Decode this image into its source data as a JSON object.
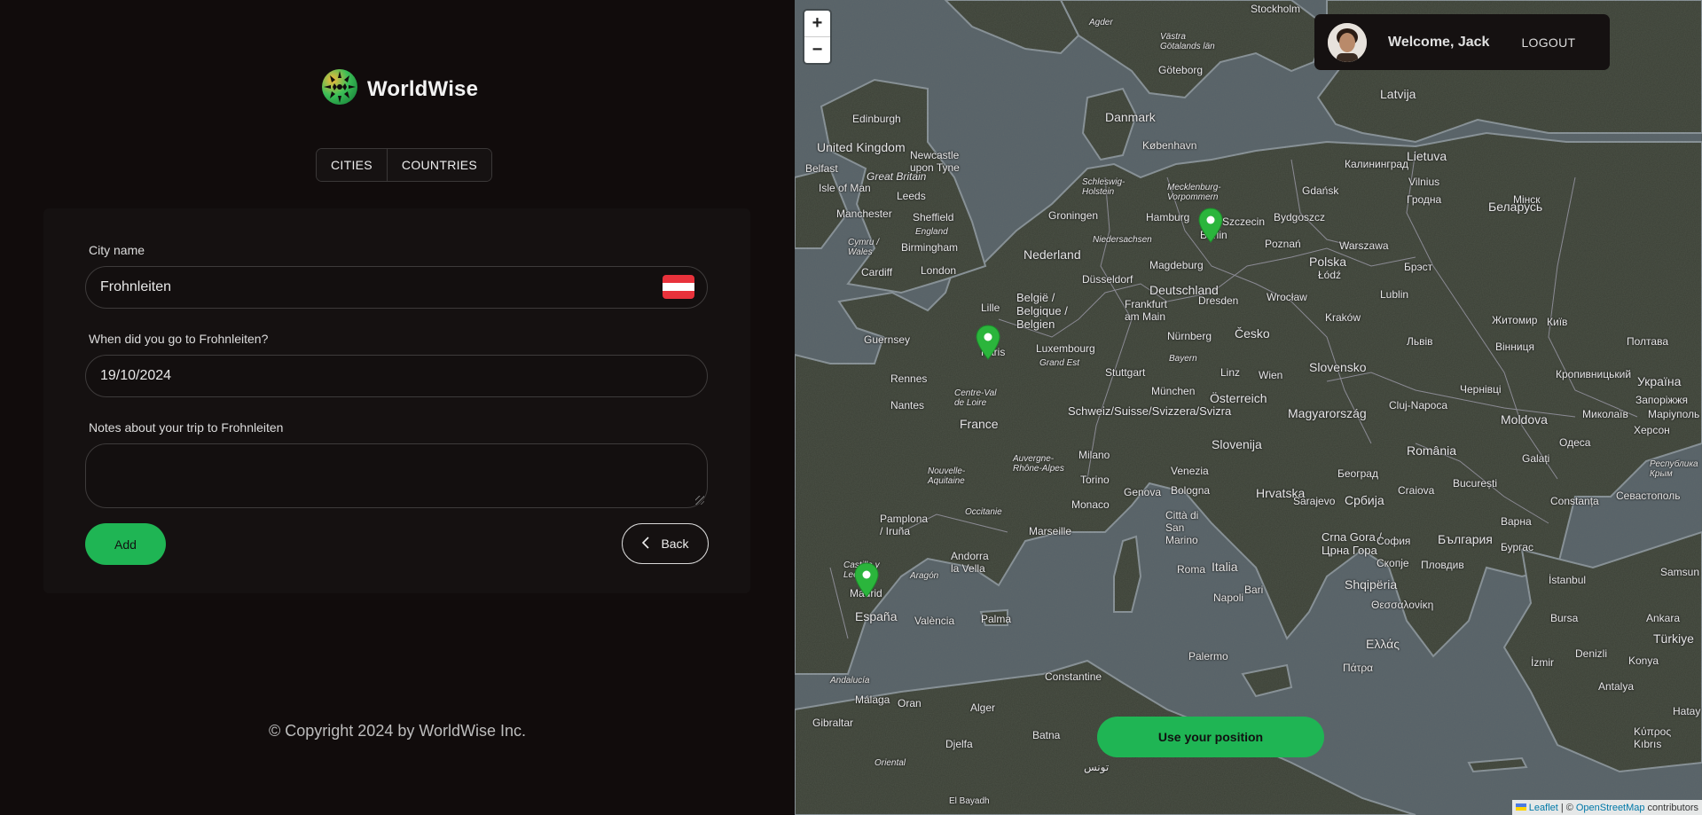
{
  "app": {
    "name": "WorldWise"
  },
  "tabs": [
    {
      "label": "CITIES"
    },
    {
      "label": "COUNTRIES"
    }
  ],
  "form": {
    "city_label": "City name",
    "city_value": "Frohnleiten",
    "flag_colors": [
      "#e8323b",
      "#ffffff",
      "#e8323b"
    ],
    "date_label": "When did you go to Frohnleiten?",
    "date_value": "19/10/2024",
    "notes_label": "Notes about your trip to Frohnleiten",
    "notes_value": "",
    "add_label": "Add",
    "back_label": "Back",
    "back_icon": "chevron-left-icon"
  },
  "footer": {
    "copyright": "© Copyright 2024 by WorldWise Inc."
  },
  "user": {
    "welcome": "Welcome, Jack",
    "logout_label": "LOGOUT"
  },
  "map": {
    "zoom_in": "+",
    "zoom_out": "−",
    "use_position_label": "Use your position",
    "attribution": {
      "leaflet": "Leaflet",
      "sep": "| ©",
      "osm": "OpenStreetMap",
      "suffix": "contributors"
    },
    "markers": [
      {
        "city": "Berlin"
      },
      {
        "city": "Paris"
      },
      {
        "city": "Madrid"
      }
    ],
    "places": {
      "united_kingdom": "United Kingdom",
      "great_britain": "Great Britain",
      "england": "England",
      "edinburgh": "Edinburgh",
      "newcastle": "Newcastle upon Tyne",
      "belfast": "Belfast",
      "isle_of_man": "Isle of Man",
      "leeds": "Leeds",
      "manchester": "Manchester",
      "sheffield": "Sheffield",
      "birmingham": "Birmingham",
      "cymru": "Cymru / Wales",
      "cardiff": "Cardiff",
      "london": "London",
      "guernsey": "Guernsey",
      "rennes": "Rennes",
      "nantes": "Nantes",
      "lille": "Lille",
      "paris": "Paris",
      "centre_val_de_loire": "Centre-Val de Loire",
      "france": "France",
      "nouvelle_aquitaine": "Nouvelle-Aquitaine",
      "occitanie": "Occitanie",
      "auvergne": "Auvergne-Rhône-Alpes",
      "marseille": "Marseille",
      "monaco": "Monaco",
      "andorra": "Andorra la Vella",
      "pamplona": "Pamplona / Iruña",
      "castilla": "Castilla y León",
      "aragon": "Aragón",
      "madrid": "Madrid",
      "espana": "España",
      "valencia": "València",
      "palma": "Palma",
      "andalucia": "Andalucía",
      "malaga": "Málaga",
      "gibraltar": "Gibraltar",
      "nederland": "Nederland",
      "belgie": "België / Belgique / Belgien",
      "dusseldorf": "Düsseldorf",
      "frankfurt": "Frankfurt am Main",
      "luxembourg": "Luxembourg",
      "grand_est": "Grand Est",
      "deutschland": "Deutschland",
      "hamburg": "Hamburg",
      "groningen": "Groningen",
      "niedersachsen": "Niedersachsen",
      "schleswig": "Schleswig-Holstein",
      "mecklenburg": "Mecklenburg-Vorpommern",
      "berlin": "Berlin",
      "szczecin": "Szczecin",
      "magdeburg": "Magdeburg",
      "dresden": "Dresden",
      "nurnberg": "Nürnberg",
      "bayern": "Bayern",
      "stuttgart": "Stuttgart",
      "munchen": "München",
      "schweiz": "Schweiz/Suisse/Svizzera/Svizra",
      "milano": "Milano",
      "torino": "Torino",
      "genova": "Genova",
      "venezia": "Venezia",
      "bologna": "Bologna",
      "italia": "Italia",
      "roma": "Roma",
      "napoli": "Napoli",
      "bari": "Bari",
      "palermo": "Palermo",
      "san_marino": "Città di San Marino",
      "osterreich": "Österreich",
      "linz": "Linz",
      "wien": "Wien",
      "cesko": "Česko",
      "slovensko": "Slovensko",
      "magyarorszag": "Magyarország",
      "slovenija": "Slovenija",
      "hrvatska": "Hrvatska",
      "beograd": "Београд",
      "srbija": "Србија",
      "sarajevo": "Sarajevo",
      "crna_gora": "Crna Gora / Црна Гора",
      "shqiperia": "Shqipëria",
      "polska": "Polska",
      "warszawa": "Warszawa",
      "poznan": "Poznań",
      "wroclaw": "Wrocław",
      "krakow": "Kraków",
      "lodz": "Łódź",
      "lublin": "Lublin",
      "gdansk": "Gdańsk",
      "bydgoszcz": "Bydgoszcz",
      "kaliningrad": "Калининград",
      "danmark": "Danmark",
      "kobenhavn": "København",
      "goteborg": "Göteborg",
      "stockholm": "Stockholm",
      "vastra_gotaland": "Västra Götalands län",
      "agder": "Agder",
      "lietuva": "Lietuva",
      "latvija": "Latvija",
      "vilnius": "Vilnius",
      "hrodna": "Гродна",
      "belarus": "Беларусь",
      "minsk": "Мінск",
      "brest": "Брэст",
      "lviv": "Львів",
      "kyiv": "Київ",
      "zhytomyr": "Житомир",
      "ukraina": "Україна",
      "vinnytsia": "Вінниця",
      "poltava": "Полтава",
      "chernivtsi": "Чернівці",
      "kropyvnytskyi": "Кропивницький",
      "moldova": "Moldova",
      "mykolaiv": "Миколаїв",
      "odesa": "Одеса",
      "kherson": "Херсон",
      "cluj": "Cluj-Napoca",
      "romania": "România",
      "bucuresti": "București",
      "craiova": "Craiova",
      "constanta": "Constanța",
      "galati": "Galați",
      "sofia": "София",
      "bulgaria": "България",
      "varna": "Варна",
      "burgas": "Бургас",
      "plovdiv": "Пловдив",
      "skopje": "Скопје",
      "ellada": "Ελλάς",
      "thessaloniki": "Θεσσαλονίκη",
      "patra": "Πάτρα",
      "istanbul": "İstanbul",
      "bursa": "Bursa",
      "izmir": "İzmir",
      "turkiye": "Türkiye",
      "samsun": "Samsun",
      "ankara": "Ankara",
      "sevastopol": "Севастополь",
      "krym": "Республика Крым",
      "zaporizhzhia": "Запоріжжя",
      "mariupol": "Маріуполь",
      "constantine": "Constantine",
      "alger": "Alger",
      "oran": "Oran",
      "djelfa": "Djelfa",
      "batna": "Batna",
      "tunis": "تونس",
      "el_bayadh": "El Bayadh",
      "oriental": "Oriental",
      "antalya": "Antalya",
      "kibris": "Κύπρος Kıbrıs",
      "denizli": "Denizli",
      "konya": "Konya",
      "hatay": "Hatay"
    }
  }
}
